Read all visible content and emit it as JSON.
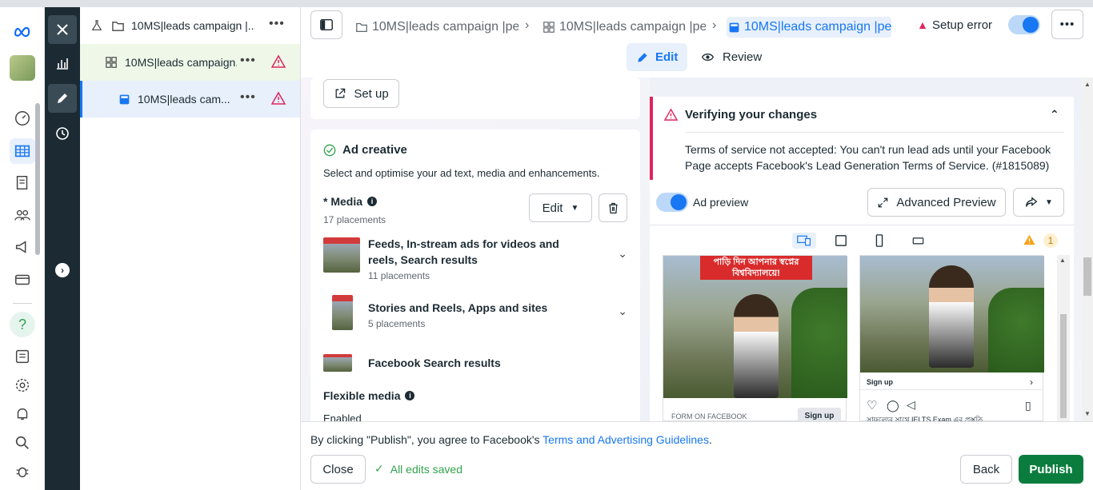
{
  "tree": {
    "campaign_label": "10MS|leads campaign |...",
    "adset_label": "10MS|leads campaign...",
    "ad_label": "10MS|leads cam...",
    "more": "•••"
  },
  "header": {
    "crumbs": [
      "10MS|leads campaign |pe",
      "10MS|leads campaign |pe",
      "10MS|leads campaign |pe"
    ],
    "chevron": "›",
    "setup_error": "Setup error",
    "edit_label": "Edit",
    "review_label": "Review"
  },
  "editor": {
    "setup_label": "Set up",
    "ad_creative_title": "Ad creative",
    "ad_creative_desc": "Select and optimise your ad text, media and enhancements.",
    "media_label": "* Media",
    "media_placements": "17 placements",
    "edit_label": "Edit",
    "placements": [
      {
        "title": "Feeds, In-stream ads for videos and reels, Search results",
        "count": "11 placements"
      },
      {
        "title": "Stories and Reels, Apps and sites",
        "count": "5 placements"
      },
      {
        "title": "Facebook Search results",
        "count": ""
      }
    ],
    "flexible_media": "Flexible media",
    "flexible_status": "Enabled"
  },
  "preview": {
    "verify_title": "Verifying your changes",
    "verify_body": "Terms of service not accepted: You can't run lead ads until your Facebook Page accepts Facebook's Lead Generation Terms of Service. (#1815089)",
    "ad_preview_label": "Ad preview",
    "advanced_preview": "Advanced Preview",
    "warning_count": "1",
    "mock1_banner": "পাড়ি দিন আপনার স্বপ্নের বিশ্ববিদ্যালয়ে!",
    "mock1_form": "FORM ON FACEBOOK",
    "mock1_cta": "Sign up",
    "mock2_cta": "Sign up",
    "mock2_caption": "সাফল্যের সাথে IELTS Exam এর প্রস্তুতি"
  },
  "footer": {
    "consent_prefix": "By clicking \"Publish\", you agree to Facebook's ",
    "consent_link": "Terms and Advertising Guidelines",
    "consent_suffix": ".",
    "close_label": "Close",
    "saved_label": "All edits saved",
    "back_label": "Back",
    "publish_label": "Publish"
  },
  "colors": {
    "accent": "#1877f2",
    "publish": "#0a7d3e",
    "error": "#e0245e",
    "dark_rail": "#1c2b33"
  }
}
